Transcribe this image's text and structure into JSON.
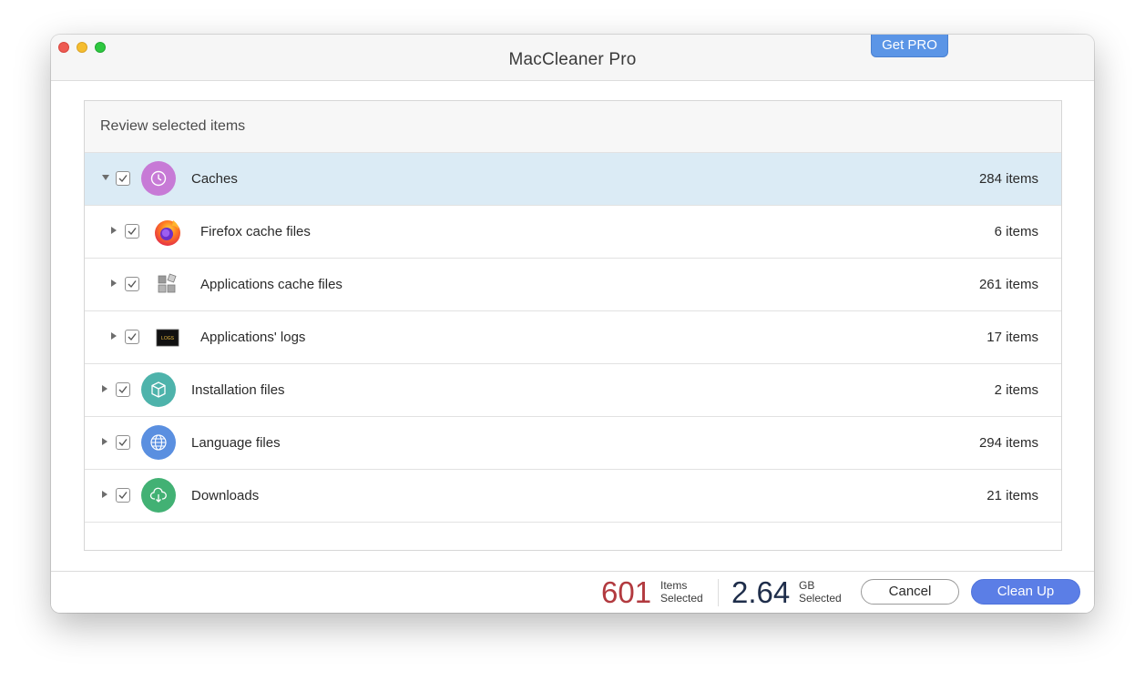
{
  "window": {
    "title": "MacCleaner Pro",
    "get_pro_label": "Get PRO"
  },
  "panel": {
    "header": "Review selected items",
    "rows": [
      {
        "label": "Caches",
        "count": "284 items",
        "icon": "clock-icon",
        "color": "#c77ad6",
        "level": 0,
        "expanded": true,
        "selected": true
      },
      {
        "label": "Firefox cache files",
        "count": "6 items",
        "icon": "firefox-icon",
        "level": 1,
        "expanded": false
      },
      {
        "label": "Applications cache files",
        "count": "261 items",
        "icon": "app-blocks-icon",
        "level": 1,
        "expanded": false
      },
      {
        "label": "Applications' logs",
        "count": "17 items",
        "icon": "logs-icon",
        "level": 1,
        "expanded": false
      },
      {
        "label": "Installation files",
        "count": "2 items",
        "icon": "package-icon",
        "color": "#4eb3ab",
        "level": 0,
        "expanded": false
      },
      {
        "label": "Language files",
        "count": "294 items",
        "icon": "globe-icon",
        "color": "#5a8fe0",
        "level": 0,
        "expanded": false
      },
      {
        "label": "Downloads",
        "count": "21 items",
        "icon": "cloud-download-icon",
        "color": "#42b174",
        "level": 0,
        "expanded": false
      }
    ],
    "logs_icon_text": "LOGS"
  },
  "footer": {
    "items_value": "601",
    "items_label_1": "Items",
    "items_label_2": "Selected",
    "items_color": "#b23a3f",
    "size_value": "2.64",
    "size_label_1": "GB",
    "size_label_2": "Selected",
    "size_color": "#1e2d4a",
    "cancel_label": "Cancel",
    "clean_label": "Clean Up"
  }
}
